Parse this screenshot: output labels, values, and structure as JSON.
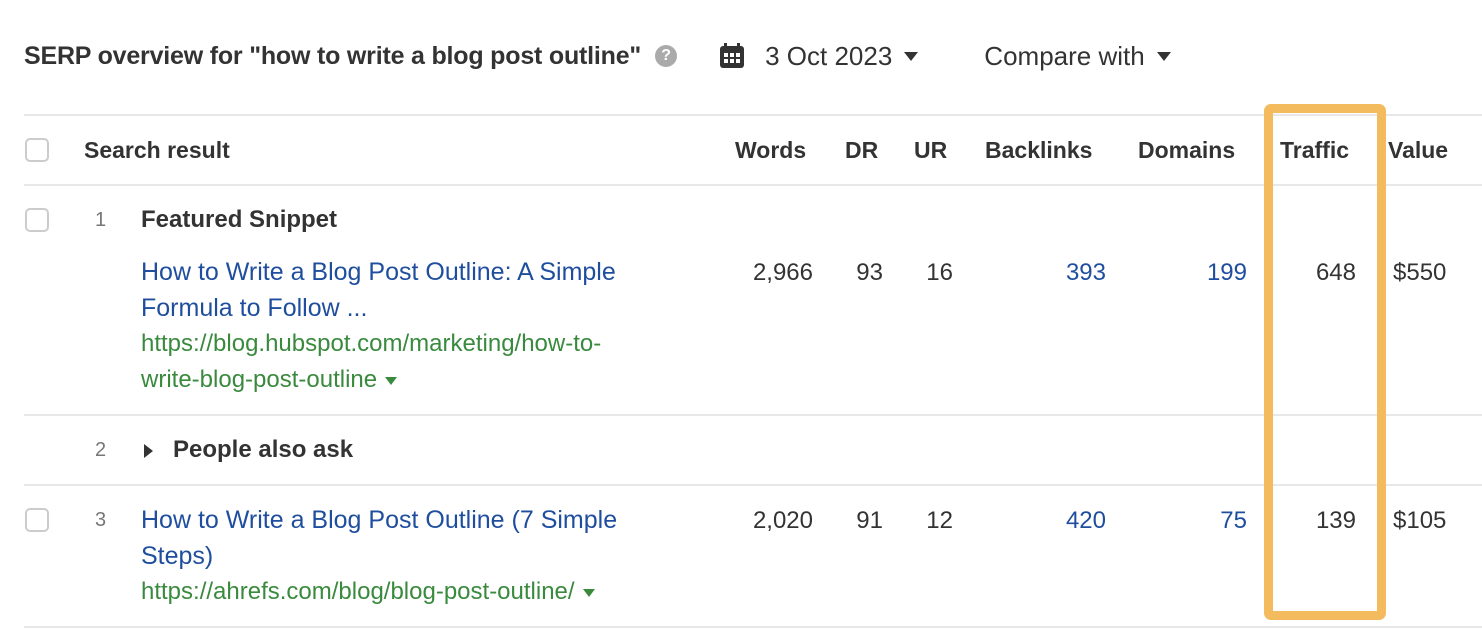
{
  "header": {
    "title": "SERP overview for \"how to write a blog post outline\"",
    "help_icon": "?",
    "date": "3 Oct 2023",
    "compare_label": "Compare with"
  },
  "table": {
    "columns": [
      "Search result",
      "Words",
      "DR",
      "UR",
      "Backlinks",
      "Domains",
      "Traffic",
      "Value"
    ],
    "rows": [
      {
        "rank": "1",
        "type_label": "Featured Snippet",
        "title_lines": [
          "How to Write a Blog Post Outline: A Simple",
          "Formula to Follow ..."
        ],
        "url_lines": [
          "https://blog.hubspot.com/marketing/how-to-",
          "write-blog-post-outline"
        ],
        "words": "2,966",
        "dr": "93",
        "ur": "16",
        "backlinks": "393",
        "domains": "199",
        "traffic": "648",
        "value": "$550"
      },
      {
        "rank": "2",
        "type_label": "People also ask"
      },
      {
        "rank": "3",
        "title_lines": [
          "How to Write a Blog Post Outline (7 Simple",
          "Steps)"
        ],
        "url_lines": [
          "https://ahrefs.com/blog/blog-post-outline/"
        ],
        "words": "2,020",
        "dr": "91",
        "ur": "12",
        "backlinks": "420",
        "domains": "75",
        "traffic": "139",
        "value": "$105"
      }
    ]
  },
  "colors": {
    "link": "#1f4e9e",
    "url": "#3a8a3e",
    "highlight": "#f3bb5e"
  }
}
